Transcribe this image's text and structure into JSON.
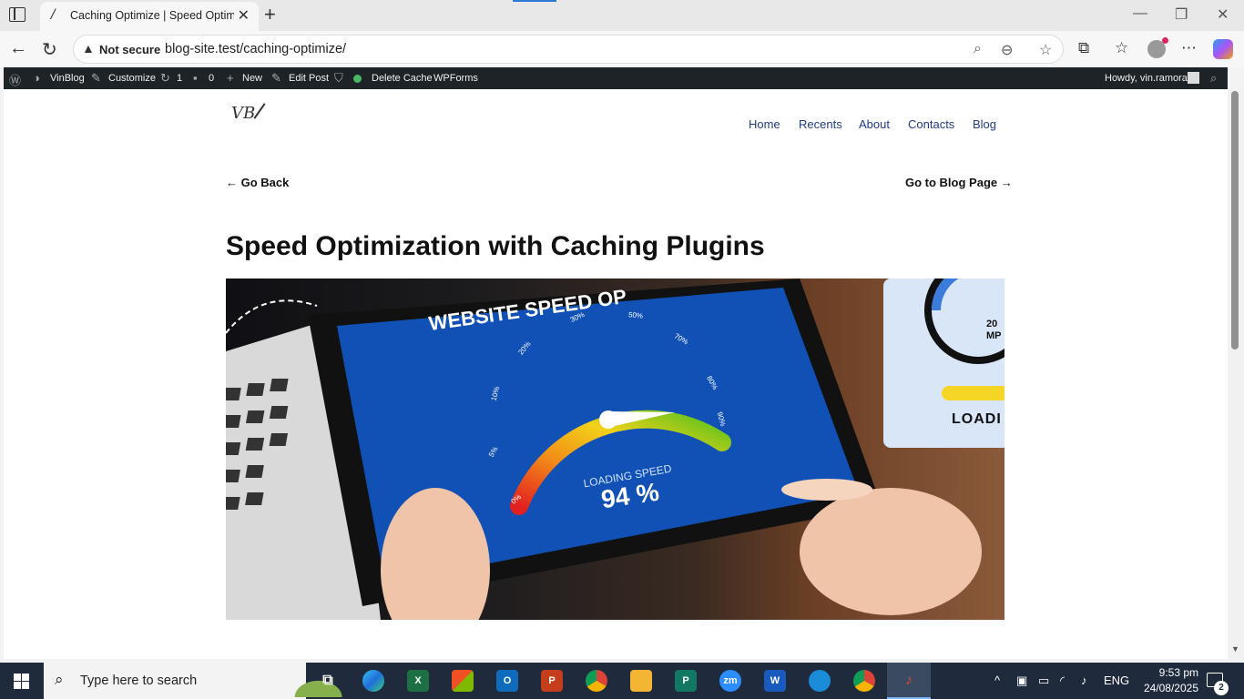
{
  "browser": {
    "tab_title": "Caching Optimize | Speed Optimi",
    "tab_favicon": "/",
    "not_secure_label": "Not secure",
    "url": "blog-site.test/caching-optimize/"
  },
  "admin_bar": {
    "site_name": "VinBlog",
    "customize": "Customize",
    "updates_count": "1",
    "comments_count": "0",
    "new_label": "New",
    "edit_post": "Edit Post",
    "delete_cache": "Delete Cache",
    "wpforms": "WPForms",
    "greeting": "Howdy, vin.ramoran"
  },
  "site": {
    "logo_text": "VB",
    "nav": [
      "Home",
      "Recents",
      "About",
      "Contacts",
      "Blog"
    ]
  },
  "post": {
    "go_back": "← Go Back",
    "go_blog": "Go to Blog Page →",
    "title": "Speed Optimization with Caching Plugins"
  },
  "hero_image": {
    "headline": "WEBSITE SPEED OP",
    "gauge_caption": "LOADING SPEED",
    "gauge_value": "94 %",
    "gauge_ticks": [
      "0%",
      "5%",
      "10%",
      "20%",
      "30%",
      "50%",
      "70%",
      "80%",
      "90%"
    ],
    "side_value": "20",
    "side_unit": "MP",
    "side_label": "LOADI"
  },
  "taskbar": {
    "search_placeholder": "Type here to search",
    "language": "ENG",
    "time": "9:53 pm",
    "date": "24/08/2025",
    "notification_count": "2"
  }
}
